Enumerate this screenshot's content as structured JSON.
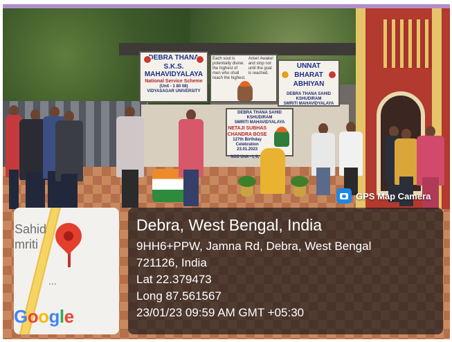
{
  "banners": {
    "left": {
      "line1": "DEBRA THANA",
      "line2": "S.K.S. MAHAVIDYALAYA",
      "line3": "National Service Scheme",
      "line4": "(Unit - 1 80 08)",
      "line5": "VIDYASAGAR UNIVERSITY"
    },
    "quote": {
      "text1": "Arise! Awake! and stop not until the goal is reached.",
      "text2": "Each soul is potentially divine. the highest of men who shall reach the highest."
    },
    "right": {
      "line1": "UNNAT",
      "line2": "BHARAT",
      "line3": "ABHIYAN",
      "line4": "DEBRA THANA SAHID KSHUDIRAM",
      "line5": "SMRITI MAHAVIDYALAYA"
    },
    "lower": {
      "line1": "DEBRA THANA SAHID KSHUDIRAM",
      "line2": "SMRITI MAHAVIDYALAYA",
      "line3": "NETAJI SUBHAS CHANDRA BOSE",
      "line4": "127th Birthday Celebration 23.01.2023",
      "line5": "NSS Unit - I, II, III"
    }
  },
  "overlay": {
    "camera_label": "GPS Map Camera",
    "map": {
      "place_label_1": "Sahid",
      "place_label_2": "mriti",
      "ellipsis": "...",
      "logo": {
        "g": "G",
        "o1": "o",
        "o2": "o",
        "g2": "g",
        "l": "l",
        "e": "e"
      }
    },
    "info": {
      "title": "Debra, West Bengal, India",
      "address_line1": "9HH6+PPW, Jamna Rd, Debra, West Bengal",
      "address_line2": "721126, India",
      "latitude": "Lat 22.379473",
      "longitude": "Long 87.561567",
      "timestamp": "23/01/23 09:59 AM GMT +05:30"
    }
  },
  "colors": {
    "frame_top": "#b28ec8",
    "overlay_bg": "#16181c",
    "pin": "#e33e2e",
    "google_blue": "#4285f4",
    "google_red": "#ea4335",
    "google_yellow": "#fbbc05",
    "google_green": "#34a853",
    "camera_icon": "#1e88e5"
  }
}
